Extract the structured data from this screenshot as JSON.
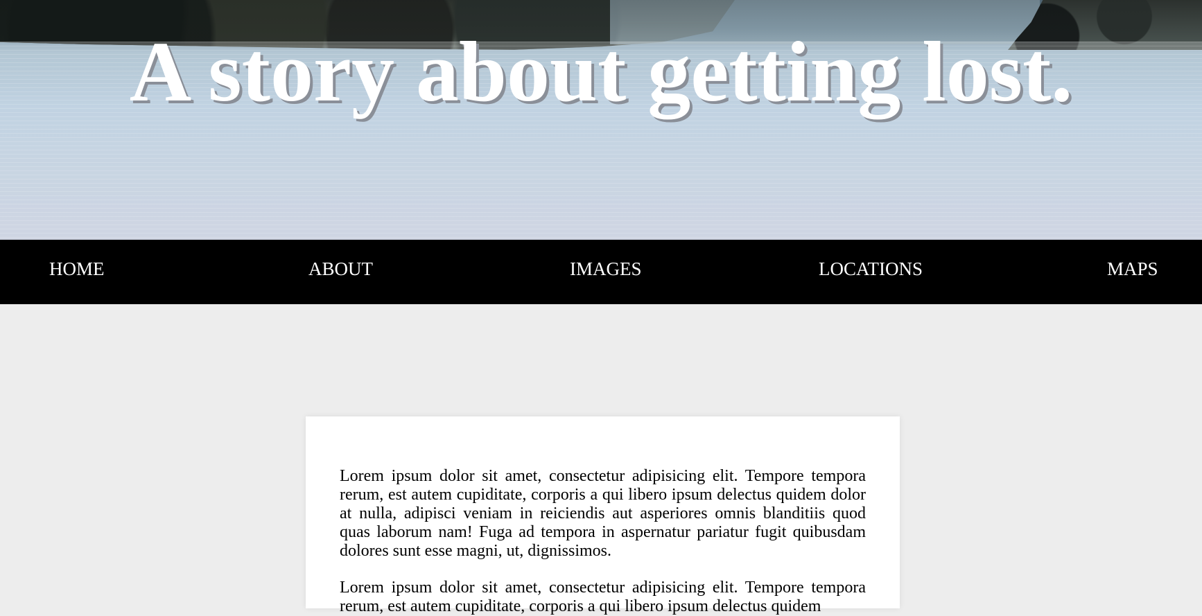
{
  "hero": {
    "title": "A story about getting lost."
  },
  "nav": {
    "items": [
      {
        "label": "HOME"
      },
      {
        "label": "ABOUT"
      },
      {
        "label": "IMAGES"
      },
      {
        "label": "LOCATIONS"
      },
      {
        "label": "MAPS"
      }
    ]
  },
  "content": {
    "paragraphs": [
      "Lorem ipsum dolor sit amet, consectetur adipisicing elit. Tempore tempora rerum, est autem cupiditate, corporis a qui libero ipsum delectus quidem dolor at nulla, adipisci veniam in reiciendis aut asperiores omnis blanditiis quod quas laborum nam! Fuga ad tempora in aspernatur pariatur fugit quibusdam dolores sunt esse magni, ut, dignissimos.",
      "Lorem ipsum dolor sit amet, consectetur adipisicing elit. Tempore tempora rerum, est autem cupiditate, corporis a qui libero ipsum delectus quidem"
    ]
  }
}
